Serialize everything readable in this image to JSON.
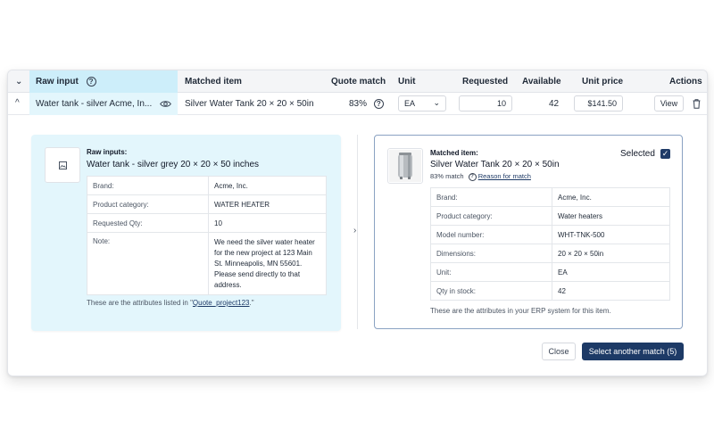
{
  "header": {
    "raw_input": "Raw input",
    "matched_item": "Matched item",
    "quote_match": "Quote match",
    "unit": "Unit",
    "requested": "Requested",
    "available": "Available",
    "unit_price": "Unit price",
    "actions": "Actions"
  },
  "row": {
    "raw_input": "Water tank - silver Acme, In...",
    "matched_item": "Silver Water Tank 20 × 20 × 50in",
    "quote_match": "83%",
    "unit": "EA",
    "requested": "10",
    "available": "42",
    "unit_price": "$141.50",
    "view_label": "View"
  },
  "raw_panel": {
    "label": "Raw inputs:",
    "title": "Water tank - silver grey 20 × 20 × 50 inches",
    "attributes": [
      {
        "key": "Brand:",
        "value": "Acme, Inc."
      },
      {
        "key": "Product category:",
        "value": "WATER HEATER"
      },
      {
        "key": "Requested Qty:",
        "value": "10"
      },
      {
        "key": "Note:",
        "value": "We need the silver water heater for the new project at 123 Main St. Minneapolis, MN 55601. Please send directly to that address."
      }
    ],
    "footnote_prefix": "These are the attributes listed in \"",
    "footnote_link": "Quote_project123",
    "footnote_suffix": ".\""
  },
  "matched_panel": {
    "label": "Matched item:",
    "title": "Silver Water Tank 20 × 20 × 50in",
    "match_pct": "83% match",
    "reason_link": "Reason for match",
    "selected_label": "Selected",
    "attributes": [
      {
        "key": "Brand:",
        "value": "Acme, Inc."
      },
      {
        "key": "Product category:",
        "value": "Water heaters"
      },
      {
        "key": "Model number:",
        "value": "WHT-TNK-500"
      },
      {
        "key": "Dimensions:",
        "value": "20 × 20 × 50in"
      },
      {
        "key": "Unit:",
        "value": "EA"
      },
      {
        "key": "Qty in stock:",
        "value": "42"
      }
    ],
    "footnote": "These are the attributes in your ERP system for this item."
  },
  "footer": {
    "close": "Close",
    "select_another": "Select another match (5)"
  },
  "icons": {
    "collapse": "chevron-down-icon",
    "help": "question-circle-icon",
    "eye": "eye-icon",
    "trash": "trash-icon",
    "image": "image-placeholder-icon"
  },
  "colors": {
    "raw_accent": "#cdeefa",
    "raw_panel_bg": "#e3f6fc",
    "primary": "#1d3a66",
    "matched_border": "#8aa2c2"
  }
}
